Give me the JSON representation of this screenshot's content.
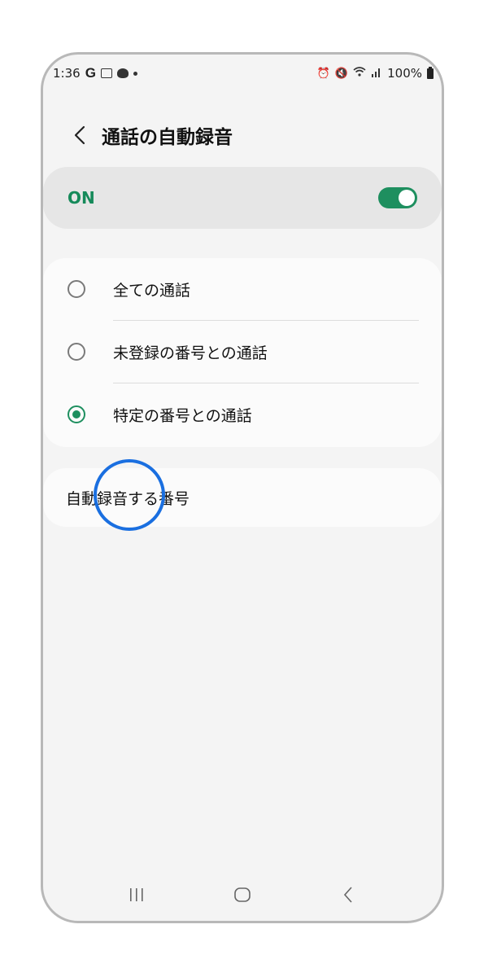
{
  "status_bar": {
    "time": "1:36",
    "google_letter": "G",
    "battery_text": "100%"
  },
  "header": {
    "title": "通話の自動録音"
  },
  "master_switch": {
    "label": "ON",
    "enabled": true,
    "accent_color": "#1e8f5f"
  },
  "record_options": {
    "items": [
      {
        "label": "全ての通話",
        "selected": false
      },
      {
        "label": "未登録の番号との通話",
        "selected": false
      },
      {
        "label": "特定の番号との通話",
        "selected": true
      }
    ]
  },
  "auto_record_numbers": {
    "label": "自動録音する番号"
  },
  "nav_bar": {
    "icons": [
      "recents-icon",
      "home-icon",
      "back-icon"
    ]
  },
  "tap_indicator_color": "#1a6fe0"
}
